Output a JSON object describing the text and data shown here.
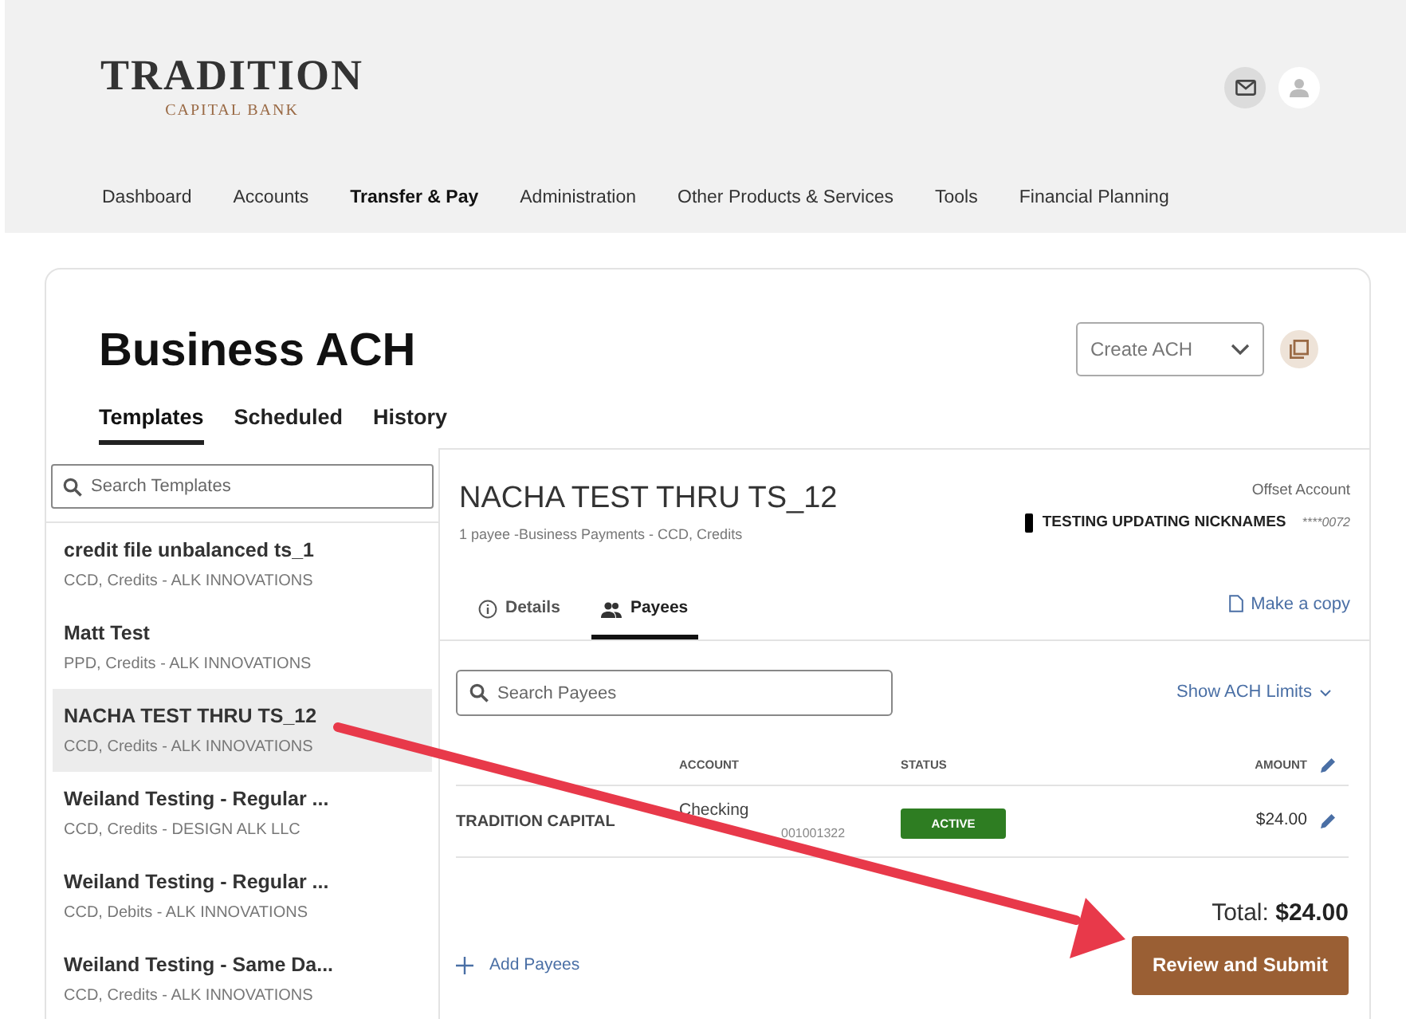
{
  "logo": {
    "name": "TRADITION",
    "subtitle": "CAPITAL BANK"
  },
  "nav": [
    {
      "label": "Dashboard",
      "selected": false
    },
    {
      "label": "Accounts",
      "selected": false
    },
    {
      "label": "Transfer & Pay",
      "selected": true
    },
    {
      "label": "Administration",
      "selected": false
    },
    {
      "label": "Other Products & Services",
      "selected": false
    },
    {
      "label": "Tools",
      "selected": false
    },
    {
      "label": "Financial Planning",
      "selected": false
    }
  ],
  "page": {
    "title": "Business ACH",
    "create_select": "Create ACH"
  },
  "tabs": [
    {
      "label": "Templates",
      "selected": true
    },
    {
      "label": "Scheduled",
      "selected": false
    },
    {
      "label": "History",
      "selected": false
    }
  ],
  "templates": {
    "placeholder": "Search Templates",
    "items": [
      {
        "name": "credit file unbalanced ts_1",
        "detail": "CCD, Credits - ALK INNOVATIONS",
        "selected": false
      },
      {
        "name": "Matt Test",
        "detail": "PPD, Credits - ALK INNOVATIONS",
        "selected": false
      },
      {
        "name": "NACHA TEST THRU TS_12",
        "detail": "CCD, Credits - ALK INNOVATIONS",
        "selected": true
      },
      {
        "name": "Weiland Testing - Regular ...",
        "detail": "CCD, Credits - DESIGN ALK LLC",
        "selected": false
      },
      {
        "name": "Weiland Testing - Regular ...",
        "detail": "CCD, Debits - ALK INNOVATIONS",
        "selected": false
      },
      {
        "name": "Weiland Testing - Same Da...",
        "detail": "CCD, Credits - ALK INNOVATIONS",
        "selected": false
      }
    ]
  },
  "detail": {
    "title": "NACHA TEST THRU TS_12",
    "subtitle": "1 payee -Business Payments - CCD, Credits",
    "offset_label": "Offset Account",
    "offset_name": "TESTING UPDATING NICKNAMES",
    "offset_number": "****0072",
    "tabs": [
      {
        "label": "Details",
        "kind": "info",
        "selected": false
      },
      {
        "label": "Payees",
        "kind": "people",
        "selected": true
      }
    ],
    "copy_link": "Make a copy",
    "payee_placeholder": "Search Payees",
    "limits_link": "Show ACH Limits",
    "columns": [
      "ACCOUNT",
      "STATUS",
      "AMOUNT"
    ],
    "rows": [
      {
        "name": "TRADITION CAPITAL",
        "account_type": "Checking",
        "account_number": "001001322",
        "status": "ACTIVE",
        "amount": "$24.00"
      }
    ],
    "add_link": "Add Payees",
    "total_label": "Total:",
    "total_value": "$24.00",
    "submit": "Review and Submit"
  }
}
